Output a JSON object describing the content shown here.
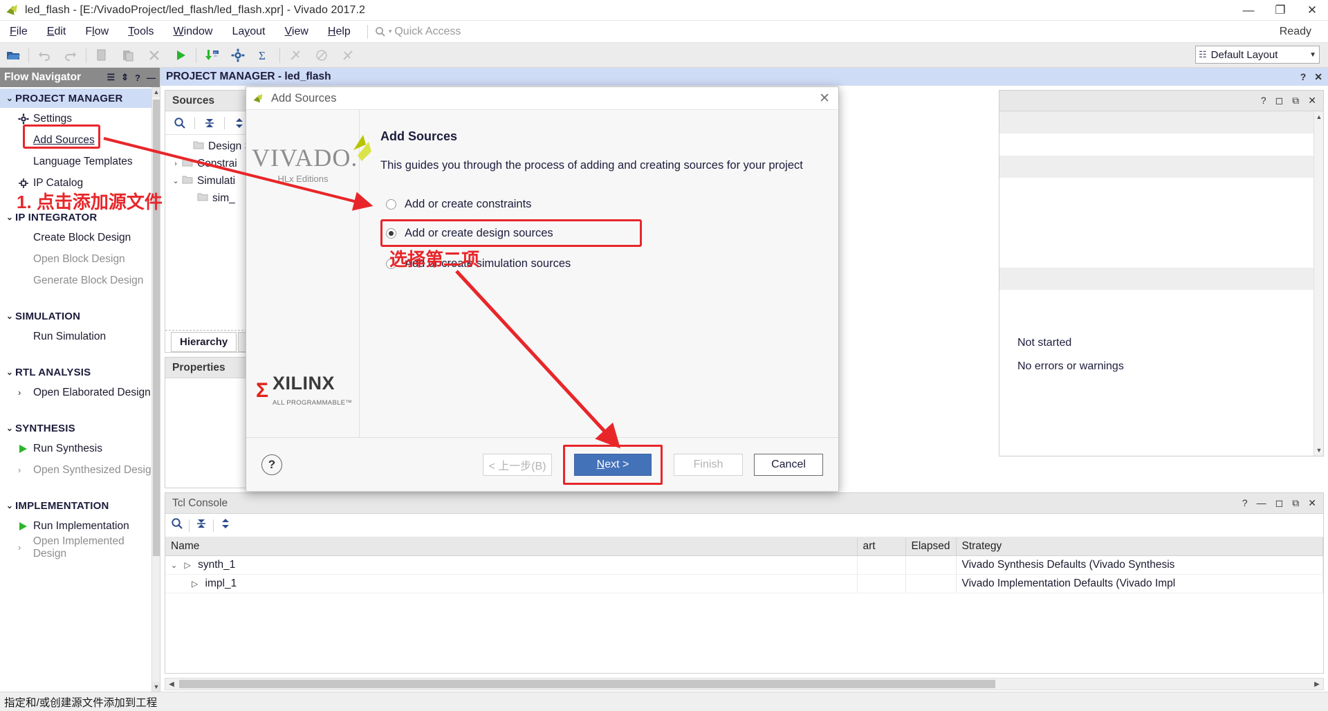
{
  "window": {
    "title": "led_flash - [E:/VivadoProject/led_flash/led_flash.xpr] - Vivado 2017.2",
    "minimize": "—",
    "maximize": "❐",
    "close": "✕"
  },
  "menubar": {
    "items": [
      "File",
      "Edit",
      "Flow",
      "Tools",
      "Window",
      "Layout",
      "View",
      "Help"
    ],
    "quick_access": "Quick Access",
    "ready": "Ready"
  },
  "toolbar": {
    "layout_select": "Default Layout",
    "layout_icon": "grid-icon"
  },
  "flow_navigator": {
    "title": "Flow Navigator",
    "groups": [
      {
        "label": "PROJECT MANAGER",
        "selected": true,
        "items": [
          {
            "label": "Settings",
            "icon": "gear-icon",
            "state": "normal"
          },
          {
            "label": "Add Sources",
            "icon": "none",
            "state": "link"
          },
          {
            "label": "Language Templates",
            "icon": "none",
            "state": "normal"
          },
          {
            "label": "IP Catalog",
            "icon": "ip-icon",
            "state": "normal"
          }
        ]
      },
      {
        "label": "IP INTEGRATOR",
        "selected": false,
        "items": [
          {
            "label": "Create Block Design",
            "icon": "none",
            "state": "normal"
          },
          {
            "label": "Open Block Design",
            "icon": "none",
            "state": "dim"
          },
          {
            "label": "Generate Block Design",
            "icon": "none",
            "state": "dim"
          }
        ]
      },
      {
        "label": "SIMULATION",
        "selected": false,
        "items": [
          {
            "label": "Run Simulation",
            "icon": "none",
            "state": "normal"
          }
        ]
      },
      {
        "label": "RTL ANALYSIS",
        "selected": false,
        "items": [
          {
            "label": "Open Elaborated Design",
            "icon": "chevron-right-icon",
            "state": "normal"
          }
        ]
      },
      {
        "label": "SYNTHESIS",
        "selected": false,
        "items": [
          {
            "label": "Run Synthesis",
            "icon": "play-icon",
            "state": "normal"
          },
          {
            "label": "Open Synthesized Design",
            "icon": "chevron-right-icon",
            "state": "dim"
          }
        ]
      },
      {
        "label": "IMPLEMENTATION",
        "selected": false,
        "items": [
          {
            "label": "Run Implementation",
            "icon": "play-icon",
            "state": "normal"
          },
          {
            "label": "Open Implemented Design",
            "icon": "chevron-right-icon",
            "state": "dim"
          }
        ]
      }
    ]
  },
  "project_bar": {
    "title": "PROJECT MANAGER - led_flash"
  },
  "sources_panel": {
    "title": "Sources",
    "tree": [
      {
        "label": "Design S",
        "twisty": "none",
        "indent": 1
      },
      {
        "label": "Constrai",
        "twisty": "›",
        "indent": 1
      },
      {
        "label": "Simulati",
        "twisty": "⌄",
        "indent": 1
      },
      {
        "label": "sim_",
        "twisty": "none",
        "indent": 2
      }
    ],
    "tabs": [
      "Hierarchy"
    ]
  },
  "properties_panel": {
    "title": "Properties"
  },
  "tcl_panel": {
    "title": "Tcl Console",
    "columns": [
      "Name",
      "art",
      "Elapsed",
      "Strategy"
    ],
    "rows": [
      {
        "name": "synth_1",
        "start": "",
        "elapsed": "",
        "strategy": "Vivado Synthesis Defaults (Vivado Synthesis"
      },
      {
        "name": "impl_1",
        "start": "",
        "elapsed": "",
        "strategy": "Vivado Implementation Defaults (Vivado Impl"
      }
    ]
  },
  "right_panel": {
    "status_lines": [
      "Not started",
      "No errors or warnings"
    ]
  },
  "dialog": {
    "title": "Add Sources",
    "heading": "Add Sources",
    "description": "This guides you through the process of adding and creating sources for your project",
    "logo": {
      "name": "VIVADO.",
      "subtitle": "HLx Editions"
    },
    "brand": {
      "mark": "Σ",
      "name": "XILINX",
      "tagline": "ALL PROGRAMMABLE™"
    },
    "options": [
      {
        "label": "Add or create constraints",
        "selected": false,
        "highlighted": false
      },
      {
        "label": "Add or create design sources",
        "selected": true,
        "highlighted": true
      },
      {
        "label": "Add or create simulation sources",
        "selected": false,
        "highlighted": false
      }
    ],
    "buttons": {
      "help": "?",
      "back": "< 上一步(B)",
      "next": "Next >",
      "finish": "Finish",
      "cancel": "Cancel"
    }
  },
  "annotations": {
    "step1": "1. 点击添加源文件",
    "step2": "选择第二项",
    "color": "#e8262a"
  },
  "statusbar": {
    "text": "指定和/或创建源文件添加到工程"
  }
}
